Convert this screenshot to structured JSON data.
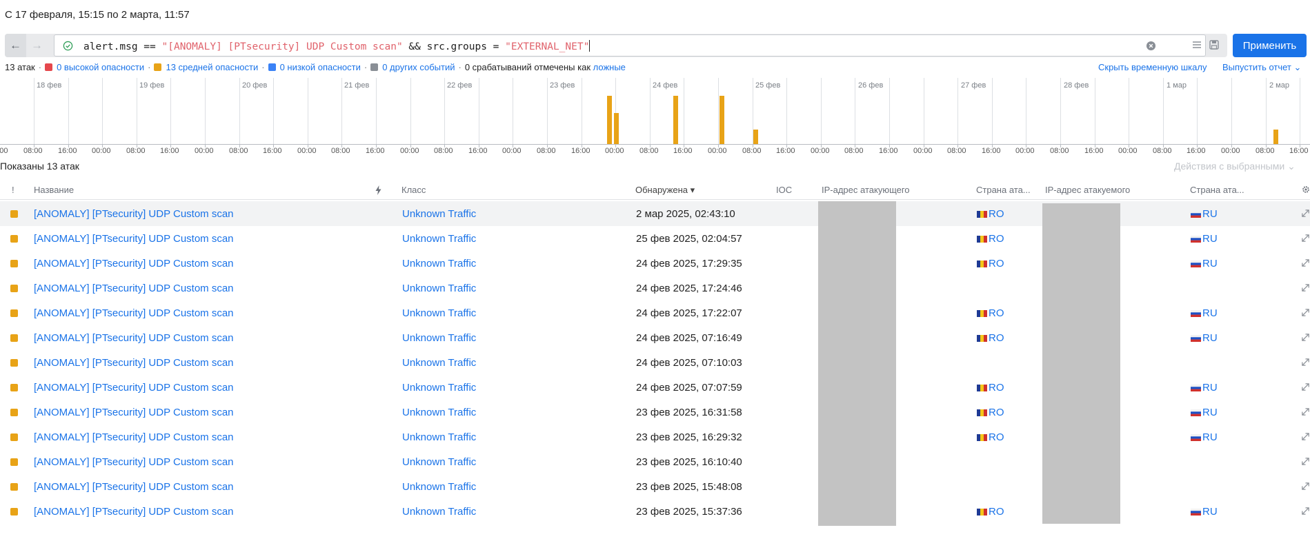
{
  "header": {
    "range_title": "С 17 февраля, 15:15 по 2 марта, 11:57"
  },
  "query": {
    "part1": "alert.msg == ",
    "str1": "\"[ANOMALY] [PTsecurity] UDP Custom scan\"",
    "part2": " && src.groups = ",
    "str2": "\"EXTERNAL_NET\"",
    "apply_label": "Применить"
  },
  "summary": {
    "total": "13 атак",
    "high": "0 высокой опасности",
    "medium": "13 средней опасности",
    "low": "0 низкой опасности",
    "other": "0 других событий",
    "false_prefix": "0 срабатываний отмечены как",
    "false_link": "ложные",
    "hide_timeline": "Скрыть временную шкалу",
    "report": "Выпустить отчет ⌄"
  },
  "colors": {
    "high": "#e5484d",
    "medium": "#e8a317",
    "low": "#3b82f6",
    "other": "#8a8f96",
    "accent": "#1a73e8"
  },
  "timeline": {
    "days": [
      "18 фев",
      "19 фев",
      "20 фев",
      "21 фев",
      "22 фев",
      "23 фев",
      "24 фев",
      "25 фев",
      "26 фев",
      "27 фев",
      "28 фев",
      "1 мар",
      "2 мар"
    ],
    "hour_labels": [
      "00:00",
      "08:00",
      "16:00"
    ]
  },
  "list": {
    "shown": "Показаны 13 атак",
    "bulk_actions": "Действия с выбранными ⌄"
  },
  "columns": {
    "severity": "!",
    "name": "Название",
    "class": "Класс",
    "detected": "Обнаружена ▾",
    "ioc": "IOC",
    "src_ip": "IP-адрес атакующего",
    "src_country": "Страна ата...",
    "dst_ip": "IP-адрес атакуемого",
    "dst_country": "Страна ата..."
  },
  "rows": [
    {
      "name": "[ANOMALY] [PTsecurity] UDP Custom scan",
      "class": "Unknown Traffic",
      "detected": "2 мар 2025, 02:43:10",
      "src_country": "RO",
      "dst_country": "RU"
    },
    {
      "name": "[ANOMALY] [PTsecurity] UDP Custom scan",
      "class": "Unknown Traffic",
      "detected": "25 фев 2025, 02:04:57",
      "src_country": "RO",
      "dst_country": "RU"
    },
    {
      "name": "[ANOMALY] [PTsecurity] UDP Custom scan",
      "class": "Unknown Traffic",
      "detected": "24 фев 2025, 17:29:35",
      "src_country": "RO",
      "dst_country": "RU"
    },
    {
      "name": "[ANOMALY] [PTsecurity] UDP Custom scan",
      "class": "Unknown Traffic",
      "detected": "24 фев 2025, 17:24:46",
      "src_country": "",
      "dst_country": ""
    },
    {
      "name": "[ANOMALY] [PTsecurity] UDP Custom scan",
      "class": "Unknown Traffic",
      "detected": "24 фев 2025, 17:22:07",
      "src_country": "RO",
      "dst_country": "RU"
    },
    {
      "name": "[ANOMALY] [PTsecurity] UDP Custom scan",
      "class": "Unknown Traffic",
      "detected": "24 фев 2025, 07:16:49",
      "src_country": "RO",
      "dst_country": "RU"
    },
    {
      "name": "[ANOMALY] [PTsecurity] UDP Custom scan",
      "class": "Unknown Traffic",
      "detected": "24 фев 2025, 07:10:03",
      "src_country": "",
      "dst_country": ""
    },
    {
      "name": "[ANOMALY] [PTsecurity] UDP Custom scan",
      "class": "Unknown Traffic",
      "detected": "24 фев 2025, 07:07:59",
      "src_country": "RO",
      "dst_country": "RU"
    },
    {
      "name": "[ANOMALY] [PTsecurity] UDP Custom scan",
      "class": "Unknown Traffic",
      "detected": "23 фев 2025, 16:31:58",
      "src_country": "RO",
      "dst_country": "RU"
    },
    {
      "name": "[ANOMALY] [PTsecurity] UDP Custom scan",
      "class": "Unknown Traffic",
      "detected": "23 фев 2025, 16:29:32",
      "src_country": "RO",
      "dst_country": "RU"
    },
    {
      "name": "[ANOMALY] [PTsecurity] UDP Custom scan",
      "class": "Unknown Traffic",
      "detected": "23 фев 2025, 16:10:40",
      "src_country": "",
      "dst_country": ""
    },
    {
      "name": "[ANOMALY] [PTsecurity] UDP Custom scan",
      "class": "Unknown Traffic",
      "detected": "23 фев 2025, 15:48:08",
      "src_country": "",
      "dst_country": ""
    },
    {
      "name": "[ANOMALY] [PTsecurity] UDP Custom scan",
      "class": "Unknown Traffic",
      "detected": "23 фев 2025, 15:37:36",
      "src_country": "RO",
      "dst_country": "RU"
    }
  ]
}
